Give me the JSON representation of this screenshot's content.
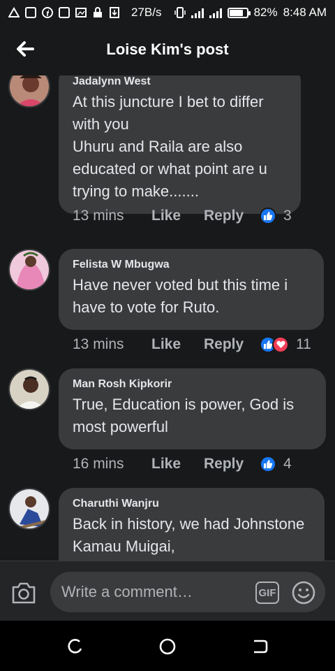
{
  "status_bar": {
    "speed": "27B/s",
    "battery": "82%",
    "battery_level": 0.82,
    "time": "8:48 AM",
    "icons": [
      "warning-icon",
      "message-icon",
      "facebook-icon",
      "gamepad-icon",
      "gallery-icon",
      "lock-icon",
      "download-icon",
      "vibrate-icon",
      "signal-icon",
      "battery-icon"
    ]
  },
  "header": {
    "title": "Loise Kim's post",
    "back_icon": "arrow-left-icon"
  },
  "comments": [
    {
      "author": "Jadalynn West",
      "text": "At this juncture I bet to differ with you\nUhuru and Raila are also educated or what point are u trying to make.......",
      "time": "13 mins",
      "like_label": "Like",
      "reply_label": "Reply",
      "reactions": [
        "like"
      ],
      "reaction_count": "3"
    },
    {
      "author": "Felista W Mbugwa",
      "text": "Have never voted but this time i have to vote for Ruto.",
      "time": "13 mins",
      "like_label": "Like",
      "reply_label": "Reply",
      "reactions": [
        "like",
        "love"
      ],
      "reaction_count": "11"
    },
    {
      "author": "Man Rosh Kipkorir",
      "text": "True, Education is power, God is most powerful",
      "time": "16 mins",
      "like_label": "Like",
      "reply_label": "Reply",
      "reactions": [
        "like"
      ],
      "reaction_count": "4"
    },
    {
      "author": "Charuthi Wanjru",
      "text": "Back in history, we had Johnstone Kamau Muigai,"
    }
  ],
  "composer": {
    "placeholder": "Write a comment…",
    "gif_label": "GIF",
    "camera_icon": "camera-icon",
    "emoji_icon": "emoji-icon"
  },
  "colors": {
    "background": "#18191a",
    "bubble": "#3a3b3c",
    "accent_like": "#1877f2",
    "accent_love": "#f33e58",
    "text_primary": "#e4e6eb",
    "text_secondary": "#b0b3b8"
  }
}
